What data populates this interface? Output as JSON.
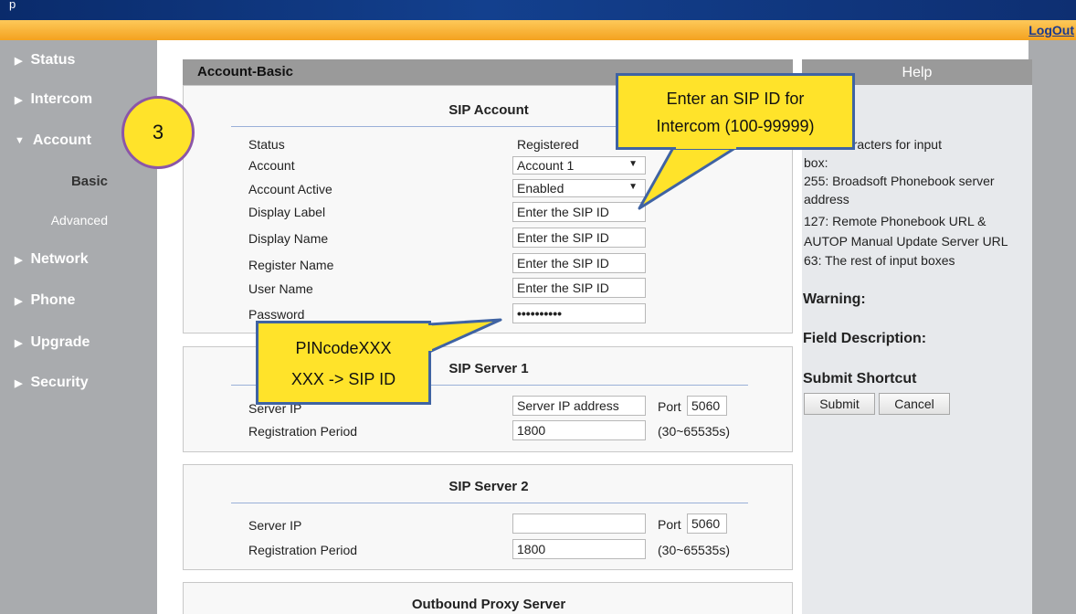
{
  "header": {
    "top_text": "p",
    "logout": "LogOut"
  },
  "sidebar": {
    "items": [
      {
        "label": "Status"
      },
      {
        "label": "Intercom"
      },
      {
        "label": "Account"
      },
      {
        "label": "Network"
      },
      {
        "label": "Phone"
      },
      {
        "label": "Upgrade"
      },
      {
        "label": "Security"
      }
    ],
    "sub": [
      {
        "label": "Basic"
      },
      {
        "label": "Advanced"
      }
    ]
  },
  "page": {
    "title": "Account-Basic"
  },
  "sip_account": {
    "header": "SIP Account",
    "status_label": "Status",
    "status_value": "Registered",
    "account_label": "Account",
    "account_value": "Account 1",
    "active_label": "Account Active",
    "active_value": "Enabled",
    "display_label_label": "Display Label",
    "display_label_value": "Enter the SIP ID",
    "display_name_label": "Display Name",
    "display_name_value": "Enter the SIP ID",
    "register_name_label": "Register Name",
    "register_name_value": "Enter the SIP ID",
    "user_name_label": "User Name",
    "user_name_value": "Enter the SIP ID",
    "password_label": "Password",
    "password_value": "••••••••••"
  },
  "sip_server_1": {
    "header": "SIP Server 1",
    "server_ip_label": "Server IP",
    "server_ip_value": "Server IP address",
    "port_label": "Port",
    "port_value": "5060",
    "reg_period_label": "Registration Period",
    "reg_period_value": "1800",
    "reg_range": "(30~65535s)"
  },
  "sip_server_2": {
    "header": "SIP Server 2",
    "server_ip_label": "Server IP",
    "server_ip_value": "",
    "port_label": "Port",
    "port_value": "5060",
    "reg_period_label": "Registration Period",
    "reg_period_value": "1800",
    "reg_range": "(30~65535s)"
  },
  "outbound": {
    "header": "Outbound Proxy Server"
  },
  "help": {
    "title": "Help",
    "line1": "th of characters for input",
    "line2": "box:",
    "line3": "255: Broadsoft Phonebook server",
    "line4": "address",
    "line5": "127: Remote Phonebook URL &",
    "line6": "AUTOP Manual Update Server URL",
    "line7": "63: The rest of input boxes",
    "warning": "Warning:",
    "field_desc": "Field Description:",
    "submit_shortcut": "Submit Shortcut",
    "submit": "Submit",
    "cancel": "Cancel"
  },
  "annotations": {
    "badge": "3",
    "callout1_line1": "Enter an SIP ID for",
    "callout1_line2": "Intercom (100-99999)",
    "callout2_line1": "PINcodeXXX",
    "callout2_line2": "XXX -> SIP ID"
  },
  "colors": {
    "accent_orange": "#f4a21f",
    "nav_gray": "#a9abae",
    "header_blue": "#13408e",
    "callout_yellow": "#ffe32a"
  }
}
